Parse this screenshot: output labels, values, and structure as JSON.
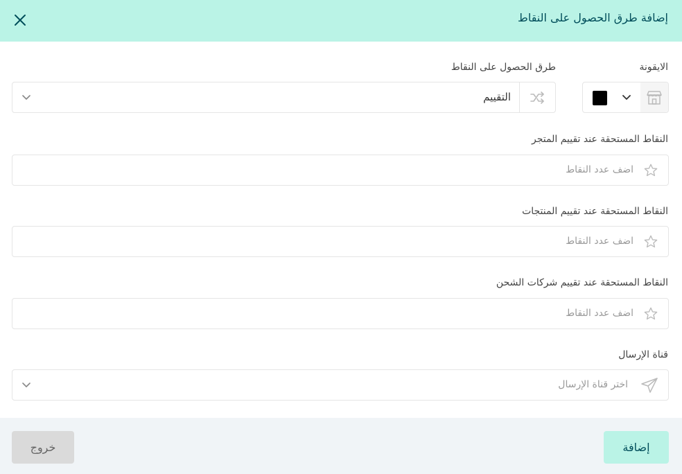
{
  "header": {
    "title": "إضافة طرق الحصول على النقاط"
  },
  "form": {
    "icon_label": "الايقونة",
    "icon_color": "#000000",
    "method_label": "طرق الحصول على النقاط",
    "method_value": "التقييم",
    "store_rating_label": "النقاط المستحقة عند تقييم المتجر",
    "store_rating_placeholder": "اضف عدد النقاط",
    "products_rating_label": "النقاط المستحقة عند تقييم المنتجات",
    "products_rating_placeholder": "اضف عدد النقاط",
    "shipping_rating_label": "النقاط المستحقة عند تقييم شركات الشحن",
    "shipping_rating_placeholder": "اضف عدد النقاط",
    "channel_label": "قناة الإرسال",
    "channel_placeholder": "اختر قناة الإرسال"
  },
  "footer": {
    "add_label": "إضافة",
    "exit_label": "خروج"
  },
  "colors": {
    "header_bg": "#baf3e6",
    "accent_text": "#004d5a",
    "footer_bg": "#f0f4f7"
  },
  "icons": [
    "close-icon",
    "store-icon",
    "chevron-down-icon",
    "shuffle-icon",
    "star-icon",
    "send-icon"
  ]
}
